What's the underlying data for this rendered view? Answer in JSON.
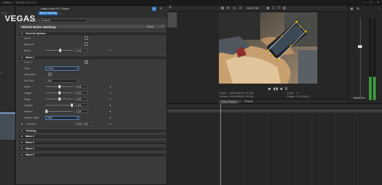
{
  "window": {
    "title": "Untitled * - VEGAS Pro 17.0",
    "min": "–",
    "max": "□",
    "close": "×"
  },
  "left_panel": {
    "ghost_label_1": "Vegas",
    "ghost_label_2": "fx"
  },
  "fx_window": {
    "title": "Video Event FX: Phone",
    "active_chip": "Bezier Masking",
    "chip_close": "×",
    "logo": "VEGAS",
    "preset_label": "Preset:",
    "preset_value": "(Default)",
    "plugin_name": "VEGAS Bezier Masking",
    "about": "About",
    "help": "?",
    "sections": {
      "general": "General Options",
      "mask1": "Mask 1",
      "tracking": "Tracking",
      "mask2": "Mask 2",
      "mask3": "Mask 3",
      "mask4": "Mask 4",
      "mask5": "Mask 5"
    },
    "general_options": {
      "invert_label": "Invert:",
      "mask_fx_label": "Mask FX:",
      "blend_label": "Blend:",
      "blend_value": "1.000",
      "blend_level": 0.55
    },
    "mask1": {
      "enable_label": "Enable:",
      "type_label": "Type:",
      "type_value": "Curve",
      "edit_mode_label": "Edit Mode:",
      "edit_tool_label": "Edit Tool:",
      "edit_tool_value": "Add",
      "width_label": "Width:",
      "width_value": "0.000",
      "width_level": 0.5,
      "height_label": "Height:",
      "height_value": "0.000",
      "height_level": 0.5,
      "angle_label": "Angle:",
      "angle_value": "0.000",
      "angle_level": 0.5,
      "opacity_label": "Opacity:",
      "opacity_value": "1.000",
      "opacity_level": 1.0,
      "feather_label": "Feather:",
      "feather_value": "0.000",
      "feather_level": 0.0,
      "feather_style_label": "Feather Style:",
      "feather_style_value": "Both",
      "location_label": "Location:",
      "location_value": "0.500, 0.500"
    },
    "pin_glyph": "⌖"
  },
  "preview": {
    "quality": "Best (Full)",
    "project_label": "Project:",
    "project_value": "1920x1080x32, 29.970p",
    "preview_label": "Preview:",
    "preview_value": "1920x1080x32, 29.970p",
    "display_label": "Display:",
    "display_value": "157x115x32",
    "frame_label": "Frame:",
    "frame_value": "0",
    "video_info": "Video Preview",
    "trimmer": "Trimmer",
    "transport_glyphs": "▶ ▮▮ ■ ☰"
  },
  "master": {
    "label": "Master Bus"
  },
  "timeline": {
    "ticks": [
      "00:00:00;00",
      "00:00:05;00",
      "00:00:10;00",
      "00:00:15;00",
      "00:00:20;00",
      "00:00:25;00",
      "00:00:30;00",
      "00:00:35;00",
      "00:00:40;00"
    ]
  },
  "colors": {
    "accent": "#2d79c7",
    "mask_path": "#e0e0e0",
    "mask_points": "#ffd400",
    "meter": "#3a9a3a"
  }
}
